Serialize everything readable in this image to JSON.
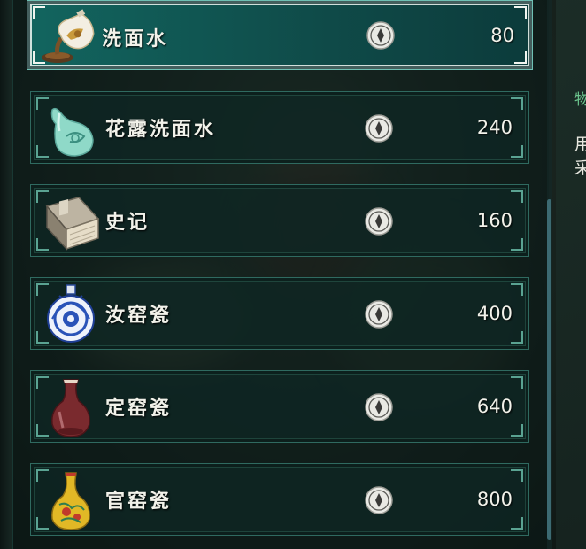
{
  "shop": {
    "items": [
      {
        "name": "洗面水",
        "price": "80",
        "icon": "wash-water-pitcher-icon",
        "selected": true
      },
      {
        "name": "花露洗面水",
        "price": "240",
        "icon": "celadon-vase-icon"
      },
      {
        "name": "史记",
        "price": "160",
        "icon": "book-icon"
      },
      {
        "name": "汝窑瓷",
        "price": "400",
        "icon": "blue-white-flask-icon"
      },
      {
        "name": "定窑瓷",
        "price": "640",
        "icon": "red-vase-icon"
      },
      {
        "name": "官窑瓷",
        "price": "800",
        "icon": "yellow-vase-icon"
      }
    ],
    "currency_icon": "copper-coin-icon"
  },
  "detail_panel": {
    "label": "物",
    "line1": "用",
    "line2": "采"
  },
  "colors": {
    "selected_bg": "#12655f",
    "item_border": "#2f6a60",
    "label_green": "#6cc58e"
  }
}
